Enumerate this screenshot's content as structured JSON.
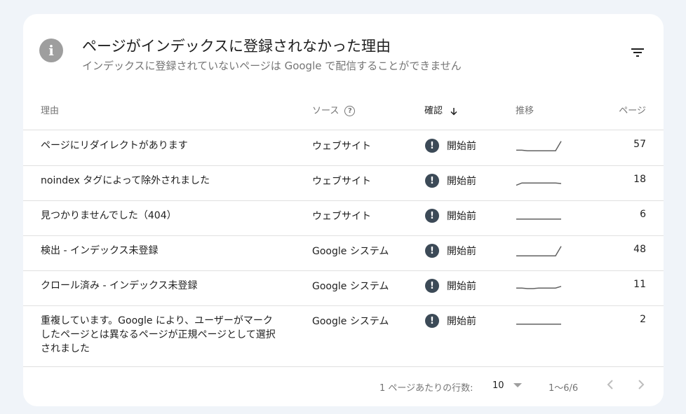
{
  "card": {
    "title": "ページがインデックスに登録されなかった理由",
    "subtitle": "インデックスに登録されていないページは Google で配信することができません",
    "info_icon_glyph": "i"
  },
  "table": {
    "headers": {
      "reason": "理由",
      "source": "ソース",
      "validation": "確認",
      "trend": "推移",
      "pages": "ページ"
    },
    "rows": [
      {
        "reason": "ページにリダイレクトがあります",
        "source": "ウェブサイト",
        "status": "開始前",
        "trend": [
          0.1,
          0.1,
          0.05,
          0.05,
          0.05,
          0.05,
          0.05,
          0.05,
          0.9
        ],
        "pages": "57"
      },
      {
        "reason": "noindex タグによって除外されました",
        "source": "ウェブサイト",
        "status": "開始前",
        "trend": [
          0.1,
          0.3,
          0.3,
          0.3,
          0.3,
          0.3,
          0.3,
          0.3,
          0.25
        ],
        "pages": "18"
      },
      {
        "reason": "見つかりませんでした（404）",
        "source": "ウェブサイト",
        "status": "開始前",
        "trend": [
          0.2,
          0.2,
          0.2,
          0.2,
          0.2,
          0.2,
          0.2,
          0.2,
          0.2
        ],
        "pages": "6"
      },
      {
        "reason": "検出 - インデックス未登録",
        "source": "Google システム",
        "status": "開始前",
        "trend": [
          0.05,
          0.05,
          0.05,
          0.05,
          0.05,
          0.05,
          0.05,
          0.05,
          0.9
        ],
        "pages": "48"
      },
      {
        "reason": "クロール済み - インデックス未登録",
        "source": "Google システム",
        "status": "開始前",
        "trend": [
          0.3,
          0.3,
          0.25,
          0.25,
          0.3,
          0.3,
          0.3,
          0.3,
          0.45
        ],
        "pages": "11"
      },
      {
        "reason": "重複しています。Google により、ユーザーがマークしたページとは異なるページが正規ページとして選択されました",
        "source": "Google システム",
        "status": "開始前",
        "trend": [
          0.2,
          0.2,
          0.2,
          0.2,
          0.2,
          0.2,
          0.2,
          0.2,
          0.2
        ],
        "pages": "2"
      }
    ]
  },
  "footer": {
    "rows_per_page_label": "1 ページあたりの行数:",
    "rows_per_page_value": "10",
    "range_text": "1〜6/6"
  },
  "colors": {
    "status_icon": "#3c4a57",
    "trend_line": "#616161",
    "background": "#f0f4f9"
  }
}
